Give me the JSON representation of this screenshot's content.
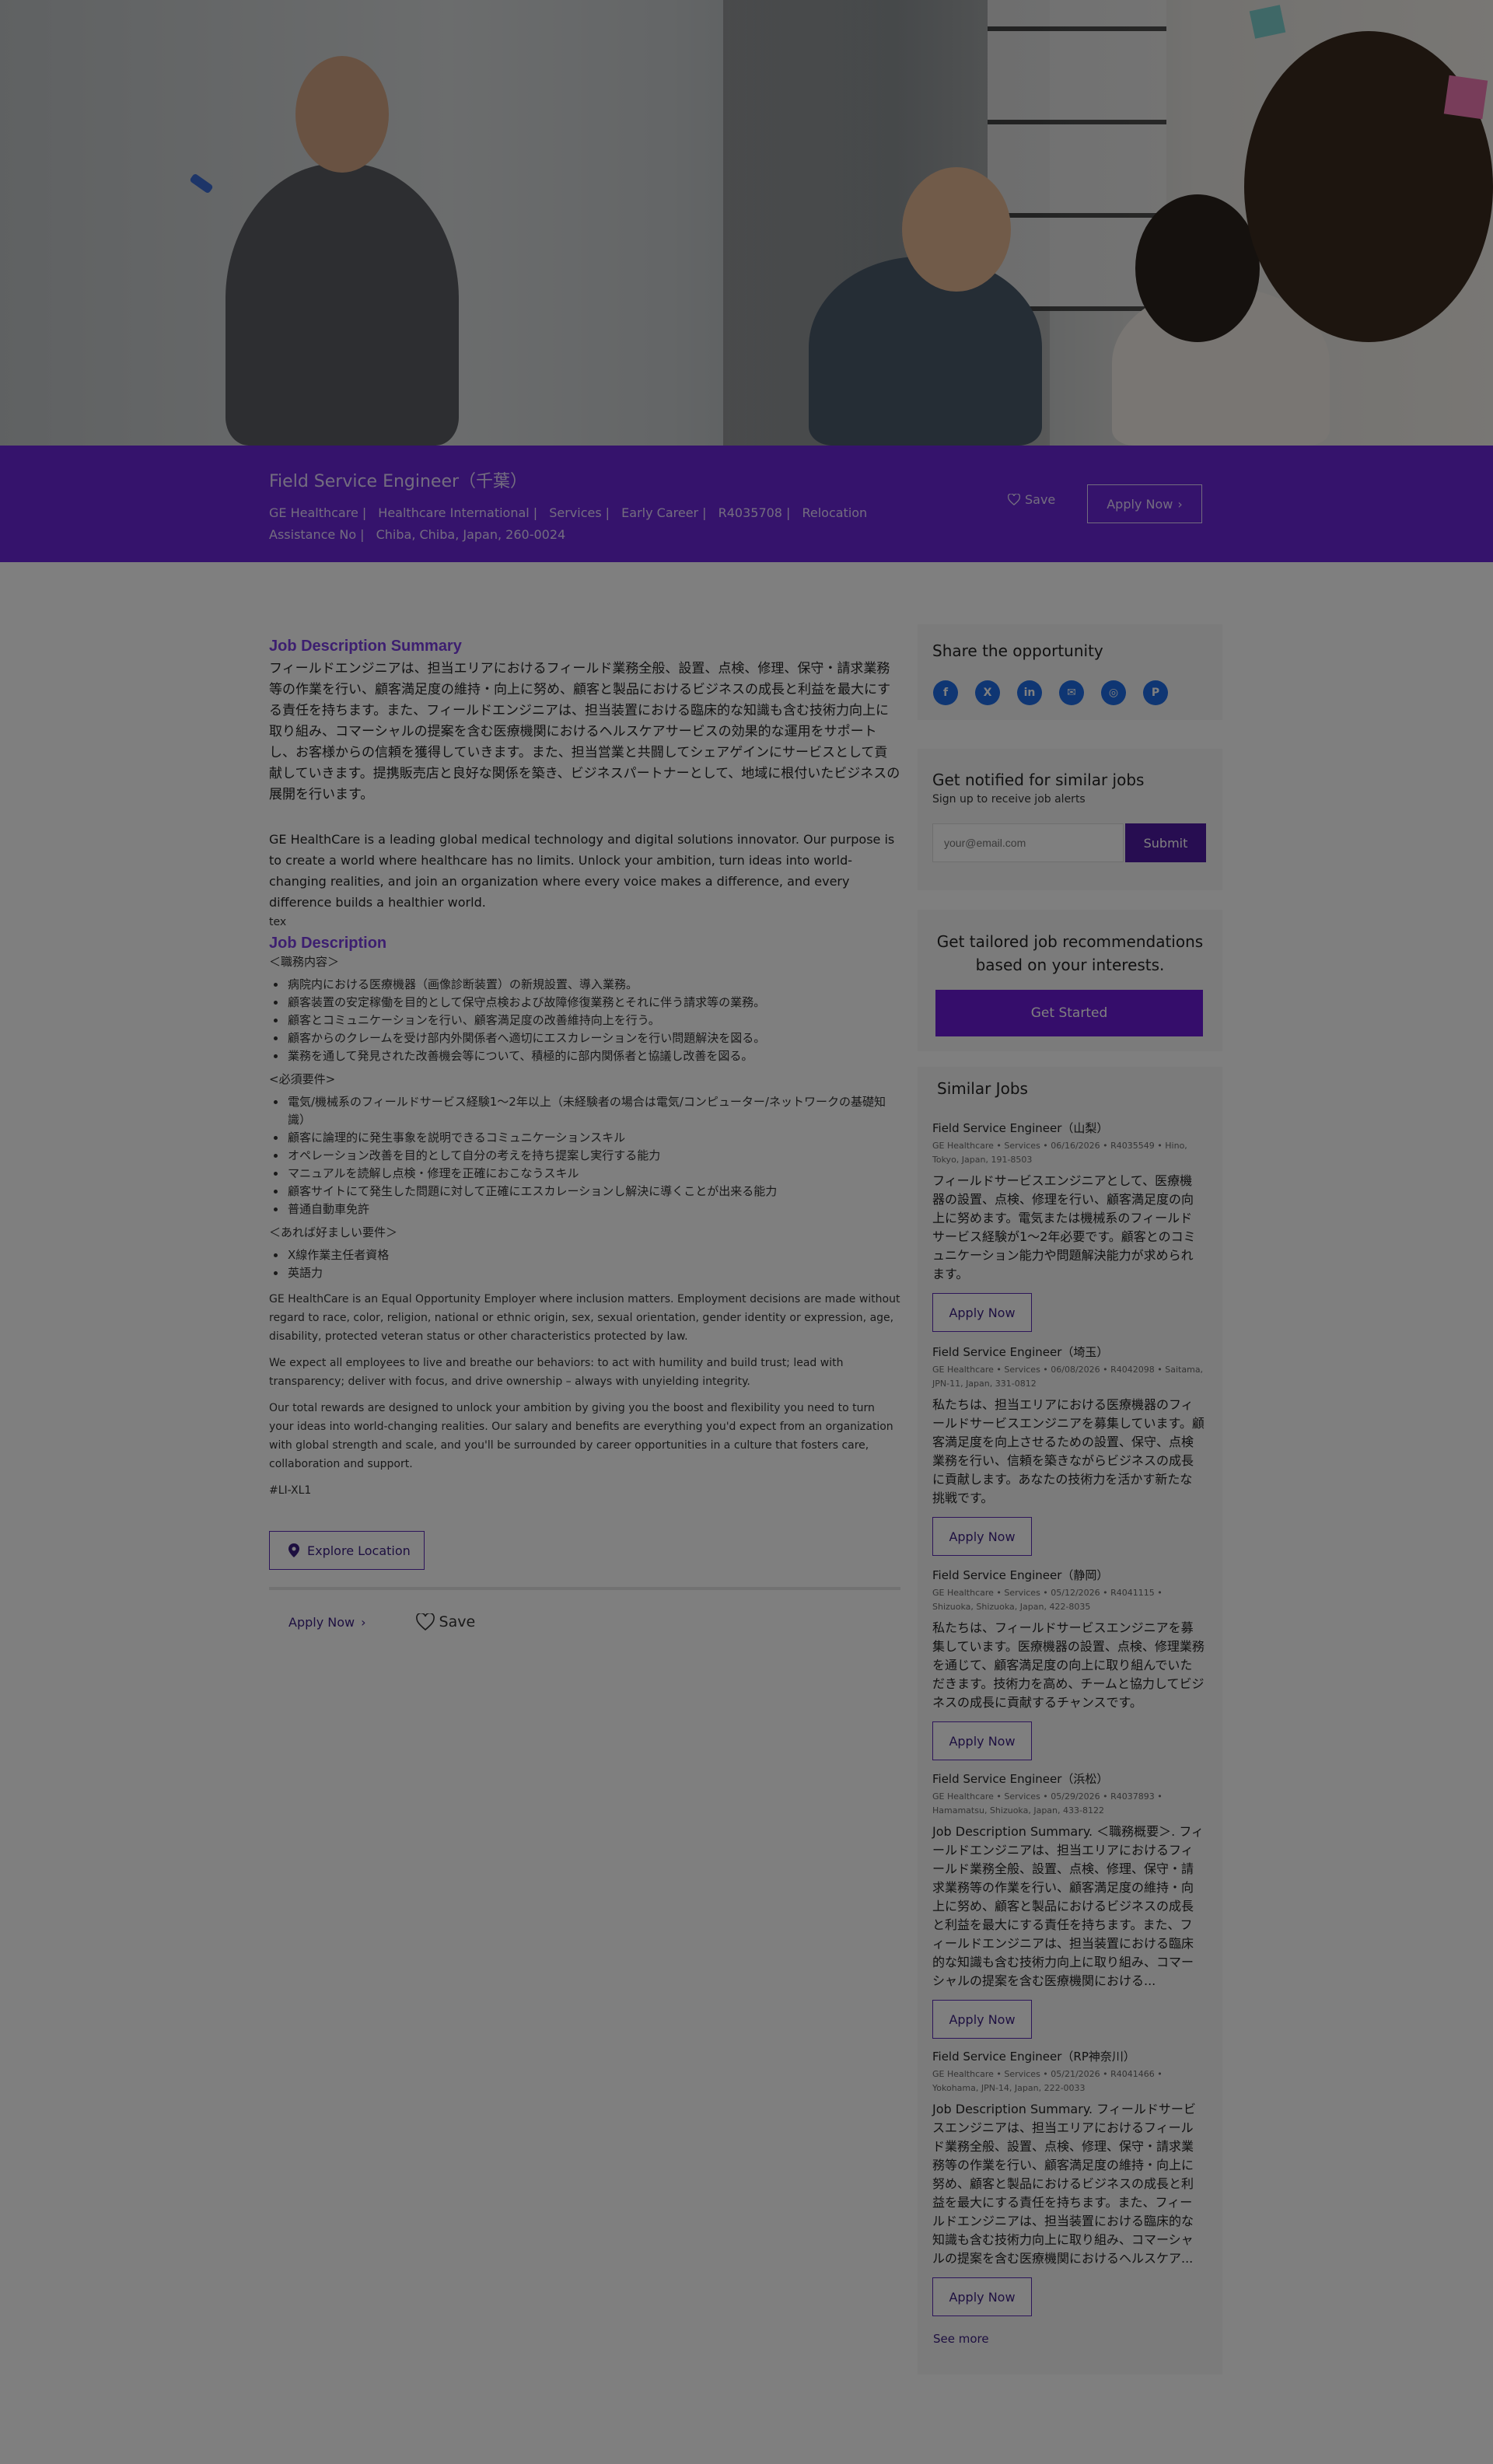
{
  "header": {
    "job_title": "Field Service Engineer（千葉）",
    "meta": [
      "GE Healthcare",
      "Healthcare International",
      "Services",
      "Early Career",
      "R4035708",
      "Relocation Assistance No",
      "Chiba, Chiba, Japan, 260-0024"
    ],
    "save_label": "Save",
    "apply_label": "Apply Now"
  },
  "main": {
    "summary_heading": "Job Description Summary",
    "summary_jp": "フィールドエンジニアは、担当エリアにおけるフィールド業務全般、設置、点検、修理、保守・請求業務等の作業を行い、顧客満足度の維持・向上に努め、顧客と製品におけるビジネスの成長と利益を最大にする責任を持ちます。また、フィールドエンジニアは、担当装置における臨床的な知識も含む技術力向上に取り組み、コマーシャルの提案を含む医療機関におけるヘルスケアサービスの効果的な運用をサポートし、お客様からの信頼を獲得していきます。また、担当営業と共闘してシェアゲインにサービスとして貢献していきます。提携販売店と良好な関係を築き、ビジネスパートナーとして、地域に根付いたビジネスの展開を行います。",
    "summary_en": "GE HealthCare is a leading global medical technology and digital solutions innovator. Our purpose is to create a world where healthcare has no limits. Unlock your ambition, turn ideas into world-changing realities, and join an organization where every voice makes a difference, and every difference builds a healthier world.",
    "tex": "tex",
    "desc_heading": "Job Description",
    "duties_heading": "＜職務内容＞",
    "duties": [
      "病院内における医療機器（画像診断装置）の新規設置、導入業務。",
      "顧客装置の安定稼働を目的として保守点検および故障修復業務とそれに伴う請求等の業務。",
      "顧客とコミュニケーションを行い、顧客満足度の改善維持向上を行う。",
      "顧客からのクレームを受け部内外関係者へ適切にエスカレーションを行い問題解決を図る。",
      "業務を通して発見された改善機会等について、積極的に部内関係者と協議し改善を図る。"
    ],
    "req_heading": "<必須要件>",
    "requirements": [
      "電気/機械系のフィールドサービス経験1～2年以上（未経験者の場合は電気/コンピューター/ネットワークの基礎知識）",
      "顧客に論理的に発生事象を説明できるコミュニケーションスキル",
      "オペレーション改善を目的として自分の考えを持ち提案し実行する能力",
      "マニュアルを読解し点検・修理を正確におこなうスキル",
      "顧客サイトにて発生した問題に対して正確にエスカレーションし解決に導くことが出来る能力",
      "普通自動車免許"
    ],
    "pref_heading": "＜あれば好ましい要件＞",
    "preferred": [
      "X線作業主任者資格",
      "英語力"
    ],
    "eeo": "GE HealthCare is an Equal Opportunity Employer where inclusion matters. Employment decisions are made without regard to race, color, religion, national or ethnic origin, sex, sexual orientation, gender identity or expression, age, disability, protected veteran status or other characteristics protected by law.",
    "behaviors": "We expect all employees to live and breathe our behaviors: to act with humility and build trust; lead with transparency; deliver with focus, and drive ownership – always with unyielding integrity.",
    "rewards": "Our total rewards are designed to unlock your ambition by giving you the boost and flexibility you need to turn your ideas into world-changing realities. Our salary and benefits are everything you'd expect from an organization with global strength and scale, and you'll be surrounded by career opportunities in a culture that fosters care, collaboration and support.",
    "tag": "#LI-XL1",
    "explore_label": "Explore Location",
    "apply_label": "Apply Now",
    "save_label": "Save"
  },
  "sidebar": {
    "share_heading": "Share the opportunity",
    "share_icons": [
      "f",
      "X",
      "in",
      "✉",
      "◎",
      "P"
    ],
    "notify_heading": "Get notified for similar jobs",
    "notify_sub": "Sign up to receive job alerts",
    "email_placeholder": "your@email.com",
    "submit_label": "Submit",
    "tailored_heading": "Get tailored job recommendations based on your interests.",
    "get_started": "Get Started",
    "similar_heading": "Similar Jobs",
    "similar_jobs": [
      {
        "title": "Field Service Engineer（山梨）",
        "meta": "GE Healthcare • Services • 06/16/2026 • R4035549 • Hino, Tokyo, Japan, 191-8503",
        "desc": "フィールドサービスエンジニアとして、医療機器の設置、点検、修理を行い、顧客満足度の向上に努めます。電気または機械系のフィールドサービス経験が1～2年必要です。顧客とのコミュニケーション能力や問題解決能力が求められます。",
        "apply": "Apply Now"
      },
      {
        "title": "Field Service Engineer（埼玉）",
        "meta": "GE Healthcare • Services • 06/08/2026 • R4042098 • Saitama, JPN-11, Japan, 331-0812",
        "desc": "私たちは、担当エリアにおける医療機器のフィールドサービスエンジニアを募集しています。顧客満足度を向上させるための設置、保守、点検業務を行い、信頼を築きながらビジネスの成長に貢献します。あなたの技術力を活かす新たな挑戦です。",
        "apply": "Apply Now"
      },
      {
        "title": "Field Service Engineer（静岡）",
        "meta": "GE Healthcare • Services • 05/12/2026 • R4041115 • Shizuoka, Shizuoka, Japan, 422-8035",
        "desc": "私たちは、フィールドサービスエンジニアを募集しています。医療機器の設置、点検、修理業務を通じて、顧客満足度の向上に取り組んでいただきます。技術力を高め、チームと協力してビジネスの成長に貢献するチャンスです。",
        "apply": "Apply Now"
      },
      {
        "title": "Field Service Engineer（浜松）",
        "meta": "GE Healthcare • Services • 05/29/2026 • R4037893 • Hamamatsu, Shizuoka, Japan, 433-8122",
        "desc": "Job Description Summary. ＜職務概要＞. フィールドエンジニアは、担当エリアにおけるフィールド業務全般、設置、点検、修理、保守・請求業務等の作業を行い、顧客満足度の維持・向上に努め、顧客と製品におけるビジネスの成長と利益を最大にする責任を持ちます。また、フィールドエンジニアは、担当装置における臨床的な知識も含む技術力向上に取り組み、コマーシャルの提案を含む医療機関における...",
        "apply": "Apply Now"
      },
      {
        "title": "Field Service Engineer（RP神奈川）",
        "meta": "GE Healthcare • Services • 05/21/2026 • R4041466 • Yokohama, JPN-14, Japan, 222-0033",
        "desc": "Job Description Summary. フィールドサービスエンジニアは、担当エリアにおけるフィールド業務全般、設置、点検、修理、保守・請求業務等の作業を行い、顧客満足度の維持・向上に努め、顧客と製品におけるビジネスの成長と利益を最大にする責任を持ちます。また、フィールドエンジニアは、担当装置における臨床的な知識も含む技術力向上に取り組み、コマーシャルの提案を含む医療機関におけるヘルスケア...",
        "apply": "Apply Now"
      }
    ],
    "see_more": "See more"
  },
  "colors": {
    "brand_purple": "#6b27d9",
    "button_purple": "#6b1bd6",
    "link_purple": "#3b1e80",
    "social_blue": "#1e6de6"
  }
}
